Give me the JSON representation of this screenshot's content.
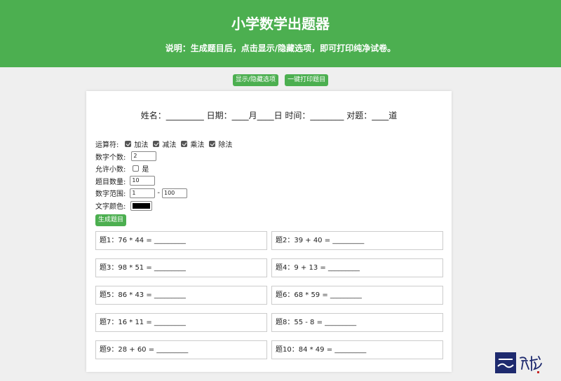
{
  "header": {
    "title": "小学数学出题器",
    "description": "说明：生成题目后，点击显示/隐藏选项，即可打印纯净试卷。"
  },
  "toolbar": {
    "toggle_label": "显示/隐藏选项",
    "print_label": "一键打印题目"
  },
  "paper": {
    "info_line": "姓名：_________ 日期：____月____日 时间：________ 对题：____道"
  },
  "settings": {
    "operators_label": "运算符:",
    "operators": [
      {
        "label": "加法",
        "checked": true
      },
      {
        "label": "减法",
        "checked": true
      },
      {
        "label": "乘法",
        "checked": true
      },
      {
        "label": "除法",
        "checked": true
      }
    ],
    "digit_count_label": "数字个数:",
    "digit_count_value": "2",
    "allow_decimal_label": "允许小数:",
    "allow_decimal_option": "是",
    "allow_decimal_checked": false,
    "question_count_label": "题目数量:",
    "question_count_value": "10",
    "range_label": "数字范围:",
    "range_min": "1",
    "range_separator": "-",
    "range_max": "100",
    "text_color_label": "文字颜色:",
    "text_color_value": "#000000",
    "generate_label": "生成题目"
  },
  "questions": [
    "题1：76 * 44 = _________",
    "题2：39 + 40 = _________",
    "题3：98 * 51 = _________",
    "题4：9 + 13 = _________",
    "题5：86 * 43 = _________",
    "题6：68 * 59 = _________",
    "题7：16 * 11 = _________",
    "题8：55 - 8 = _________",
    "题9：28 + 60 = _________",
    "题10：84 * 49 = _________"
  ],
  "colors": {
    "accent": "#4caf50",
    "background": "#efefef"
  }
}
